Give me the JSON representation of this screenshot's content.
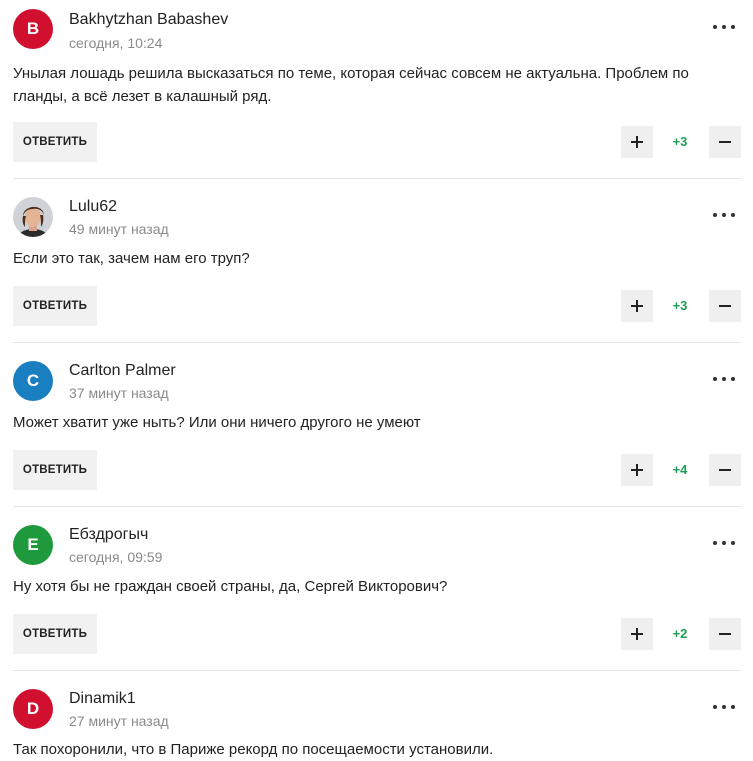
{
  "ui": {
    "reply_label": "ОТВЕТИТЬ"
  },
  "colors": {
    "score_positive": "#1a9f55",
    "avatar_red": "#d0102e",
    "avatar_blue": "#1a7fc1",
    "avatar_green": "#1e9a3c"
  },
  "comments": [
    {
      "avatar_letter": "B",
      "avatar_color": "#d0102e",
      "author": "Bakhytzhan Babashev",
      "time": "сегодня, 10:24",
      "text": "Унылая лошадь решила высказаться по теме, которая сейчас совсем не актуальна. Проблем по гланды, а всё лезет в калашный ряд.",
      "score": "+3"
    },
    {
      "avatar_letter": "",
      "avatar_icon": "user-photo-icon",
      "author": "Lulu62",
      "time": "49 минут назад",
      "text": "Если это так, зачем нам его труп?",
      "score": "+3"
    },
    {
      "avatar_letter": "C",
      "avatar_color": "#1a7fc1",
      "author": "Carlton Palmer",
      "time": "37 минут назад",
      "text": "Может хватит уже ныть? Или они ничего другого не умеют",
      "score": "+4"
    },
    {
      "avatar_letter": "E",
      "avatar_color": "#1e9a3c",
      "author": "Ебздрогыч",
      "time": "сегодня, 09:59",
      "text": "Ну хотя бы не граждан своей страны, да, Сергей Викторович?",
      "score": "+2"
    },
    {
      "avatar_letter": "D",
      "avatar_color": "#d0102e",
      "author": "Dinamik1",
      "time": "27 минут назад",
      "text": "Так похоронили, что в Париже рекорд по посещаемости установили."
    }
  ]
}
